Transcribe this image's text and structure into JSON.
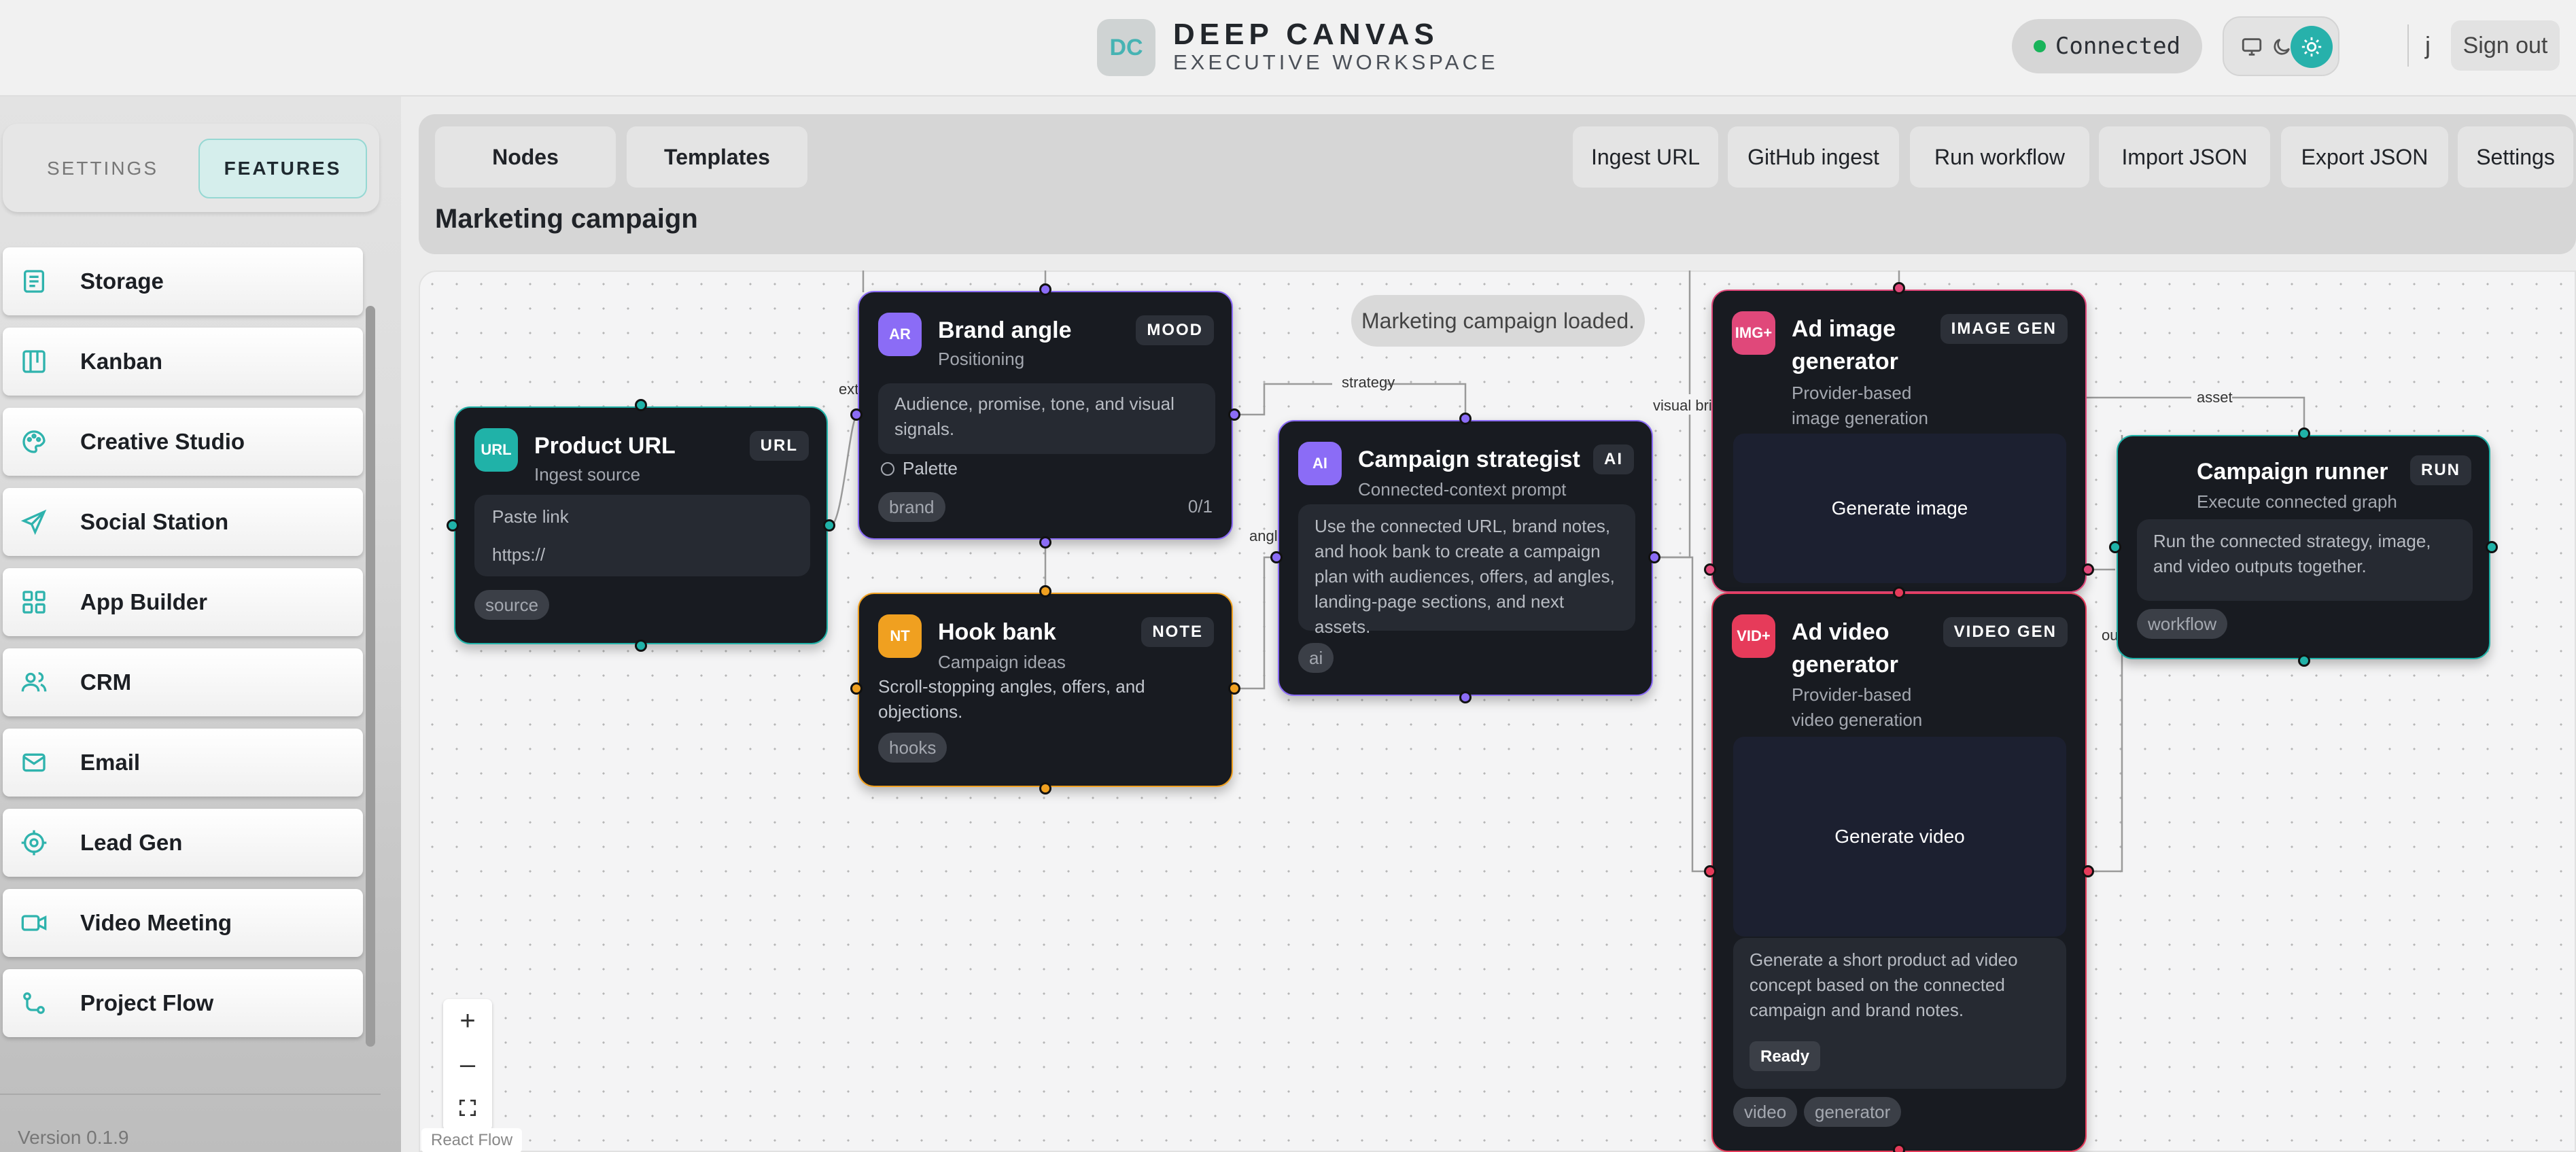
{
  "header": {
    "logo_text": "DC",
    "brand_title": "DEEP CANVAS",
    "brand_subtitle": "EXECUTIVE WORKSPACE",
    "status": "Connected",
    "user_initial": "j",
    "sign_out": "Sign out"
  },
  "sidebar": {
    "tabs": {
      "settings": "SETTINGS",
      "features": "FEATURES"
    },
    "items": [
      {
        "label": "Storage",
        "icon": "storage-icon"
      },
      {
        "label": "Kanban",
        "icon": "kanban-icon"
      },
      {
        "label": "Creative Studio",
        "icon": "palette-icon"
      },
      {
        "label": "Social Station",
        "icon": "send-icon"
      },
      {
        "label": "App Builder",
        "icon": "grid-icon"
      },
      {
        "label": "CRM",
        "icon": "users-icon"
      },
      {
        "label": "Email",
        "icon": "mail-icon"
      },
      {
        "label": "Lead Gen",
        "icon": "target-icon"
      },
      {
        "label": "Video Meeting",
        "icon": "video-icon"
      },
      {
        "label": "Project Flow",
        "icon": "flow-icon"
      }
    ],
    "version": "Version 0.1.9"
  },
  "toolbar": {
    "nodes": "Nodes",
    "templates": "Templates",
    "ingest_url": "Ingest URL",
    "github_ingest": "GitHub ingest",
    "run_workflow": "Run workflow",
    "import_json": "Import JSON",
    "export_json": "Export JSON",
    "settings": "Settings",
    "flow_title": "Marketing campaign"
  },
  "canvas": {
    "toast": "Marketing campaign loaded.",
    "attribution": "React Flow",
    "edge_labels": {
      "ext": "ext",
      "strategy": "strategy",
      "angle": "angle",
      "visual_brief": "visual brie",
      "asset": "asset",
      "out": "ou"
    },
    "colors": {
      "teal": "#20b2a8",
      "purple": "#8b6cf6",
      "amber": "#f0a020",
      "pink": "#e0487a",
      "red": "#e63b5a"
    }
  },
  "nodes": {
    "product_url": {
      "icon": "URL",
      "title": "Product URL",
      "subtitle": "Ingest source",
      "badge": "URL",
      "field_label": "Paste link",
      "field_placeholder": "https://",
      "tag": "source"
    },
    "brand_angle": {
      "icon": "AR",
      "title": "Brand angle",
      "subtitle": "Positioning",
      "badge": "MOOD",
      "body": "Audience, promise, tone, and visual signals.",
      "check": "Palette",
      "tag": "brand",
      "count": "0/1"
    },
    "hook_bank": {
      "icon": "NT",
      "title": "Hook bank",
      "subtitle": "Campaign ideas",
      "badge": "NOTE",
      "body": "Scroll-stopping angles, offers, and objections.",
      "tag": "hooks"
    },
    "strategist": {
      "icon": "AI",
      "title": "Campaign strategist",
      "subtitle": "Connected-context prompt",
      "badge": "AI",
      "body": "Use the connected URL, brand notes, and hook bank to create a campaign plan with audiences, offers, ad angles, landing-page sections, and next assets.",
      "tag": "ai"
    },
    "image_gen": {
      "icon": "IMG+",
      "title_1": "Ad image",
      "title_2": "generator",
      "subtitle_1": "Provider-based",
      "subtitle_2": "image generation",
      "badge": "IMAGE GEN",
      "action": "Generate image"
    },
    "video_gen": {
      "icon": "VID+",
      "title_1": "Ad video",
      "title_2": "generator",
      "subtitle_1": "Provider-based",
      "subtitle_2": "video generation",
      "badge": "VIDEO GEN",
      "action": "Generate video",
      "prompt": "Generate a short product ad video concept based on the connected campaign and brand notes.",
      "status": "Ready",
      "tags": [
        "video",
        "generator"
      ]
    },
    "runner": {
      "title": "Campaign runner",
      "subtitle": "Execute connected graph",
      "badge": "RUN",
      "body": "Run the connected strategy, image, and video outputs together.",
      "tag": "workflow"
    }
  }
}
